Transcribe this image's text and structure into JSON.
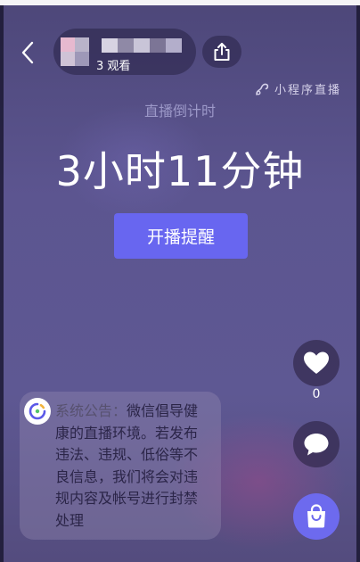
{
  "header": {
    "back_icon": "chevron-left-icon",
    "host": {
      "viewers_label": "3 观看",
      "avatar_colors": [
        "#e7b9cf",
        "#b9b3c9",
        "#cfc3d6",
        "#9e98b8"
      ],
      "name_colors": [
        "#d7d3e2",
        "#8f89a6",
        "#c9c5d8",
        "#7c7596",
        "#b3aecb"
      ]
    },
    "share_icon": "share-upload-icon"
  },
  "mini_program_badge": {
    "icon": "link-icon",
    "label": "小程序直播"
  },
  "countdown": {
    "label": "直播倒计时",
    "time": "3小时11分钟"
  },
  "remind_button": {
    "label": "开播提醒"
  },
  "actions": {
    "like_icon": "heart-icon",
    "like_count": "0",
    "comment_icon": "comment-bubble-icon",
    "shop_icon": "shopping-bag-icon"
  },
  "notice": {
    "icon": "system-notice-icon",
    "prefix": "系统公告：",
    "text": "微信倡导健康的直播环境。若发布违法、违规、低俗等不良信息，我们将会对违规内容及帐号进行封禁处理"
  },
  "colors": {
    "accent": "#6866f0",
    "shop_button": "#6d6aee",
    "background": "#5c5590"
  }
}
